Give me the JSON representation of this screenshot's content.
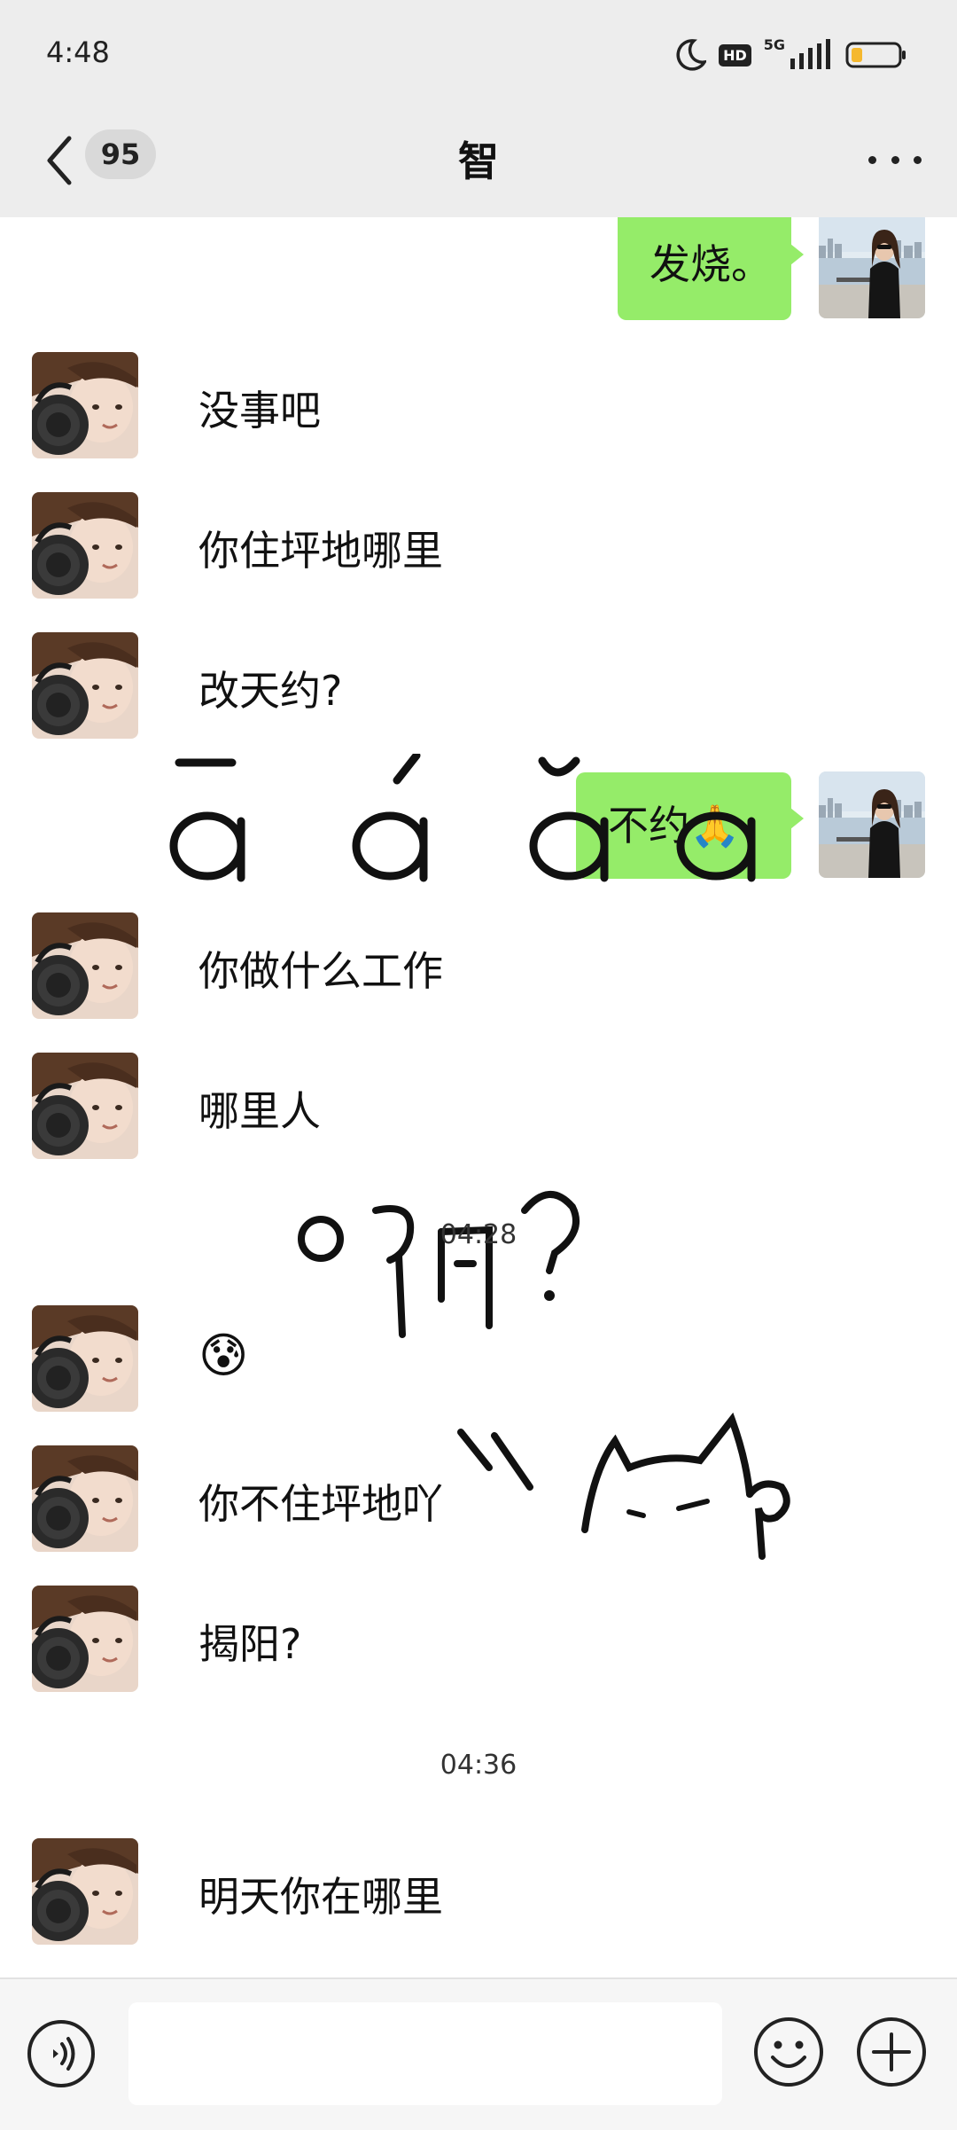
{
  "status_bar": {
    "time": "4:48",
    "network": "5G",
    "hd": "HD"
  },
  "header": {
    "unread_count": "95",
    "title": "智"
  },
  "messages": [
    {
      "side": "right",
      "text": "发烧。"
    },
    {
      "side": "left",
      "text": "没事吧"
    },
    {
      "side": "left",
      "text": "你住坪地哪里"
    },
    {
      "side": "left",
      "text": "改天约?"
    },
    {
      "side": "right",
      "text": "不约",
      "emoji": "🙏"
    },
    {
      "side": "left",
      "text": "你做什么工作"
    },
    {
      "side": "left",
      "text": "哪里人"
    },
    {
      "side": "left",
      "text": "😰"
    },
    {
      "side": "left",
      "text": "你不住坪地吖"
    },
    {
      "side": "left",
      "text": "揭阳?"
    },
    {
      "side": "left",
      "text": "明天你在哪里"
    }
  ],
  "timestamps": [
    "04:28",
    "04:36"
  ],
  "stickers": {
    "tones": [
      "ā",
      "á",
      "ǎ",
      "à"
    ],
    "question": "啊?"
  },
  "input": {
    "placeholder": ""
  },
  "colors": {
    "bubble_sent": "#95ec69",
    "header_bg": "#ededed",
    "battery_low": "#f5b82e"
  },
  "icons": [
    "back-icon",
    "more-icon",
    "voice-icon",
    "emoji-icon",
    "plus-icon",
    "moon-icon",
    "signal-icon",
    "battery-icon"
  ]
}
